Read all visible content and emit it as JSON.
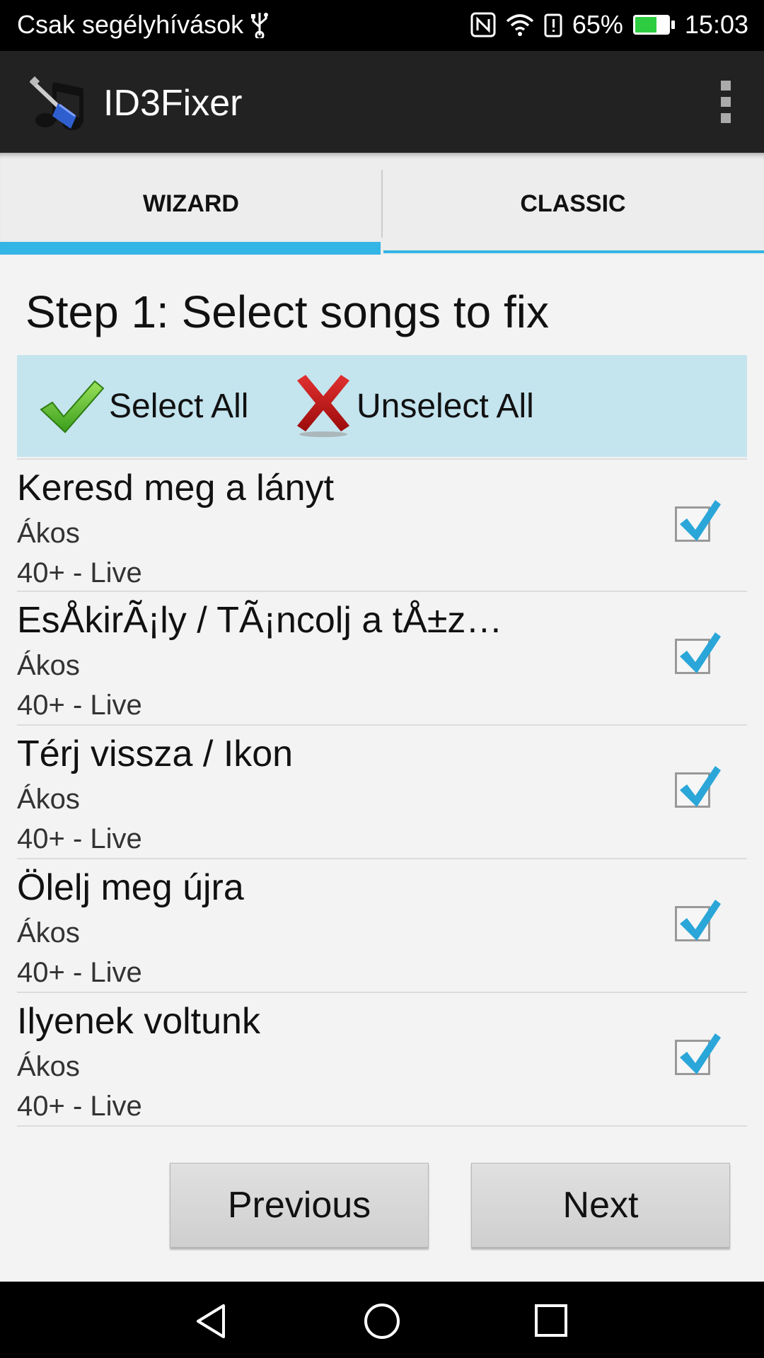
{
  "status_bar": {
    "carrier": "Csak segélyhívások",
    "usb_icon": "usb-icon",
    "nfc_icon": "nfc-icon",
    "wifi_icon": "wifi-icon",
    "alert_icon": "battery-alert-icon",
    "battery_percent": "65%",
    "battery_level": 0.65,
    "time": "15:03"
  },
  "app_bar": {
    "title": "ID3Fixer",
    "icon": "app-logo-icon",
    "overflow_icon": "more-vert-icon"
  },
  "tabs": [
    {
      "label": "WIZARD",
      "active": true
    },
    {
      "label": "CLASSIC",
      "active": false
    }
  ],
  "step_title": "Step 1: Select songs to fix",
  "select_bar": {
    "select_all": "Select All",
    "unselect_all": "Unselect All",
    "select_icon": "green-check-icon",
    "unselect_icon": "red-x-icon"
  },
  "songs": [
    {
      "title": "Keresd meg a lányt",
      "artist": "Ákos",
      "album": "40+ - Live",
      "checked": true
    },
    {
      "title": "EsÅkirÃ¡ly / TÃ¡ncolj a tÅ±z…",
      "artist": "Ákos",
      "album": "40+ - Live",
      "checked": true
    },
    {
      "title": "Térj vissza / Ikon",
      "artist": "Ákos",
      "album": "40+ - Live",
      "checked": true
    },
    {
      "title": "Ölelj meg újra",
      "artist": "Ákos",
      "album": "40+ - Live",
      "checked": true
    },
    {
      "title": "Ilyenek voltunk",
      "artist": "Ákos",
      "album": "40+ - Live",
      "checked": true
    }
  ],
  "buttons": {
    "previous": "Previous",
    "next": "Next"
  },
  "colors": {
    "accent": "#33b5e5",
    "select_bar_bg": "#c4e4ee",
    "app_bar_bg": "#222222"
  }
}
